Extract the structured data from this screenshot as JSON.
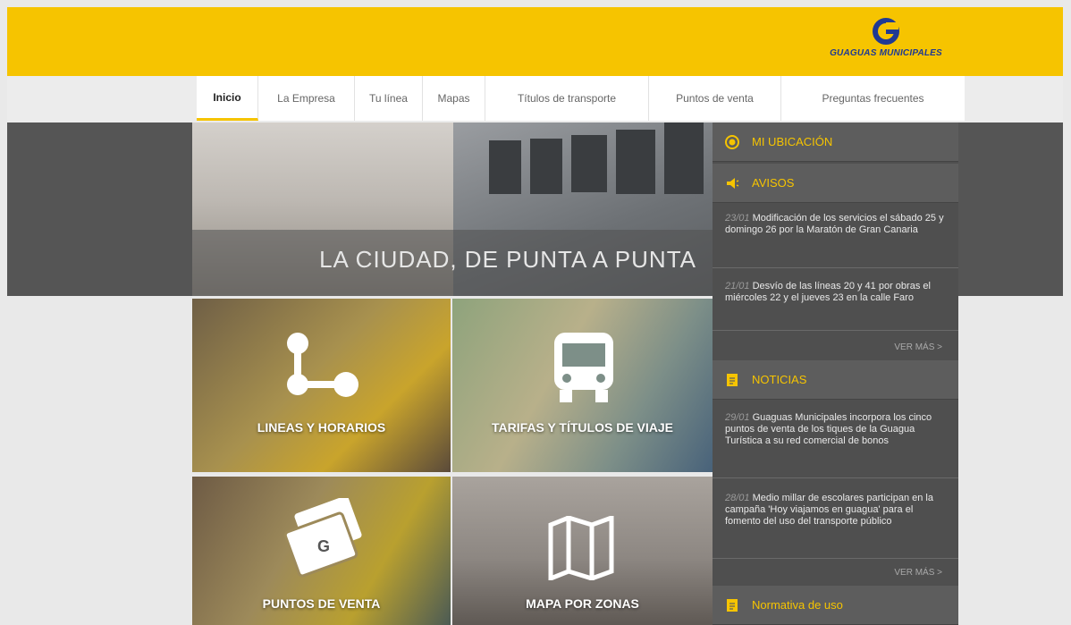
{
  "header": {
    "brand": "GUAGUAS MUNICIPALES",
    "accent": "#f6c400"
  },
  "nav": [
    {
      "label": "Inicio"
    },
    {
      "label": "La Empresa"
    },
    {
      "label": "Tu línea"
    },
    {
      "label": "Mapas"
    },
    {
      "label": "Títulos de transporte"
    },
    {
      "label": "Puntos de venta"
    },
    {
      "label": "Preguntas frecuentes"
    }
  ],
  "hero": {
    "caption": "LA CIUDAD, DE PUNTA A PUNTA"
  },
  "tiles": [
    {
      "label": "LINEAS Y HORARIOS",
      "icon": "route-icon"
    },
    {
      "label": "TARIFAS Y TÍTULOS DE VIAJE",
      "icon": "bus-icon"
    },
    {
      "label": "PUNTOS DE VENTA",
      "icon": "ticket-card-icon"
    },
    {
      "label": "MAPA POR ZONAS",
      "icon": "map-icon"
    }
  ],
  "sidebar": {
    "location": {
      "title": "MI UBICACIÓN",
      "icon": "location-target-icon"
    },
    "avisos": {
      "title": "AVISOS",
      "icon": "megaphone-icon",
      "items": [
        {
          "date": "23/01",
          "text": "Modificación de los servicios el sábado 25 y domingo 26 por la Maratón de Gran Canaria"
        },
        {
          "date": "21/01",
          "text": "Desvío de las líneas 20 y 41 por obras el miércoles 22 y el jueves 23 en la calle Faro"
        }
      ],
      "more": "VER MÁS >"
    },
    "noticias": {
      "title": "NOTICIAS",
      "icon": "document-icon",
      "items": [
        {
          "date": "29/01",
          "text": "Guaguas Municipales incorpora los cinco puntos de venta de los tiques de la Guagua Turística a su red comercial de bonos"
        },
        {
          "date": "28/01",
          "text": "Medio millar de escolares participan en la campaña 'Hoy viajamos en guagua' para el fomento del uso del transporte público"
        }
      ],
      "more": "VER MÁS >"
    },
    "normativa": {
      "title": "Normativa de uso",
      "icon": "document-icon"
    }
  }
}
